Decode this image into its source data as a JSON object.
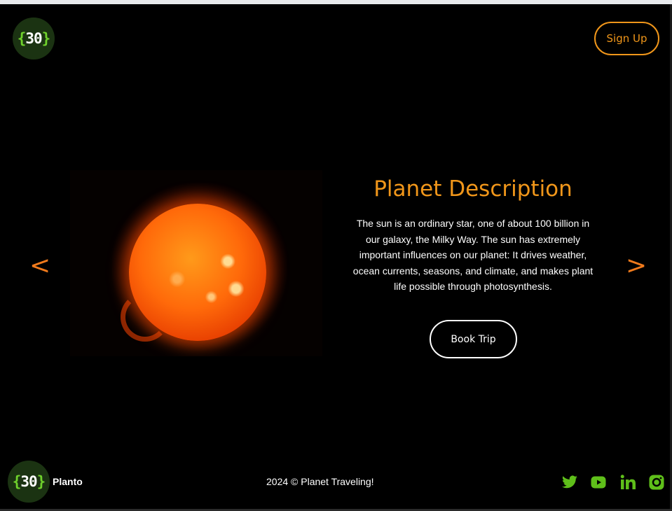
{
  "header": {
    "logo": {
      "brace_open": "{",
      "number": "30",
      "brace_close": "}"
    },
    "signup_label": "Sign Up"
  },
  "carousel": {
    "prev_label": "<",
    "next_label": ">",
    "title": "Planet Description",
    "description": "The sun is an ordinary star, one of about 100 billion in our galaxy, the Milky Way. The sun has extremely important influences on our planet: It drives weather, ocean currents, seasons, and climate, and makes plant life possible through photosynthesis.",
    "book_label": "Book Trip"
  },
  "footer": {
    "logo": {
      "brace_open": "{",
      "number": "30",
      "brace_close": "}"
    },
    "brand": "Planto",
    "copyright": "2024 © Planet Traveling!",
    "social": [
      "twitter-icon",
      "youtube-icon",
      "linkedin-icon",
      "instagram-icon"
    ]
  },
  "colors": {
    "accent": "#f0961a",
    "arrow": "#f07a1c",
    "logo_green": "#6fd12c",
    "social_green": "#5fbf1a",
    "background": "#000000"
  }
}
